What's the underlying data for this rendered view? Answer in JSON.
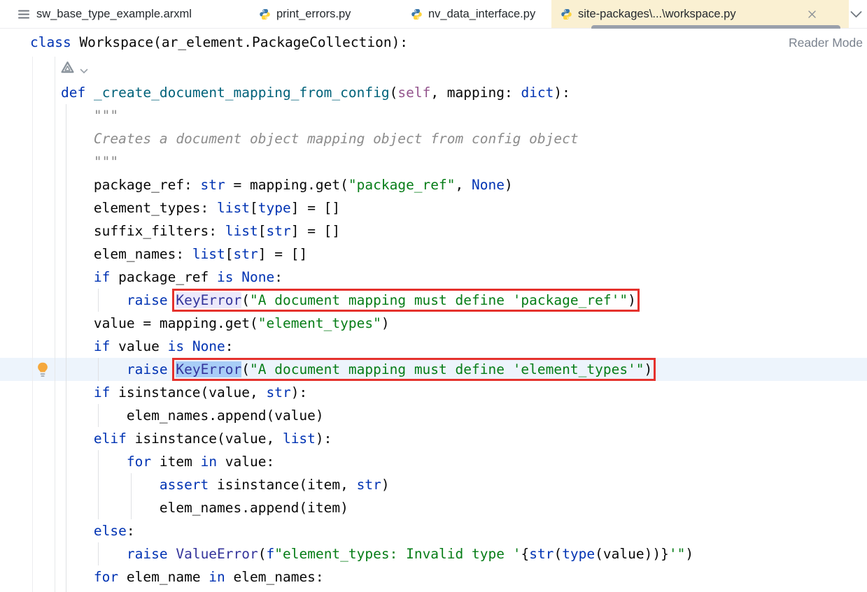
{
  "tabs": {
    "items": [
      {
        "label": "sw_base_type_example.arxml",
        "icon": "arxml-file-icon",
        "active": false,
        "closable": false
      },
      {
        "label": "print_errors.py",
        "icon": "python-icon",
        "active": false,
        "closable": false
      },
      {
        "label": "nv_data_interface.py",
        "icon": "python-icon",
        "active": false,
        "closable": false
      },
      {
        "label": "site-packages\\...\\workspace.py",
        "icon": "python-icon",
        "active": true,
        "closable": true,
        "close_icon": "close-icon"
      }
    ],
    "overflow_icon": "chevron-down-icon",
    "active_tab_bg": "#FAF0D2"
  },
  "header": {
    "signature_segments": [
      {
        "t": "class",
        "s": "kw"
      },
      {
        "t": " Workspace(ar_element.PackageCollection):",
        "s": "pl"
      }
    ],
    "reader_mode_label": "Reader Mode"
  },
  "colors": {
    "keyword": "#0033B3",
    "function_decl": "#00627A",
    "self_param": "#94558D",
    "string": "#067D17",
    "exception_ref": "#34349B",
    "docstring": "#8C8C8C",
    "annotation_box_red": "#E5322D",
    "identifier_highlight": "#ECE9FB",
    "selection_highlight": "#A8CDF7",
    "current_line": "#EDF4FC"
  },
  "editor": {
    "gutter_icons": [
      {
        "name": "lightbulb-icon",
        "line_index": 13
      },
      {
        "name": "inlay-hint-icon",
        "line_index": 0
      },
      {
        "name": "inlay-chevron-down-icon",
        "line_index": 0
      }
    ],
    "lines": [
      {
        "type": "inlay"
      },
      {
        "seg": [
          {
            "t": "    ",
            "s": "pl"
          },
          {
            "t": "def",
            "s": "kw"
          },
          {
            "t": " ",
            "s": "pl"
          },
          {
            "t": "_create_document_mapping_from_config",
            "s": "fn"
          },
          {
            "t": "(",
            "s": "pl"
          },
          {
            "t": "self",
            "s": "self"
          },
          {
            "t": ", mapping: ",
            "s": "pl"
          },
          {
            "t": "dict",
            "s": "kw"
          },
          {
            "t": "):",
            "s": "pl"
          }
        ]
      },
      {
        "seg": [
          {
            "t": "        \"\"\"",
            "s": "doc"
          }
        ]
      },
      {
        "seg": [
          {
            "t": "        Creates a document object mapping object from config object",
            "s": "doc"
          }
        ]
      },
      {
        "seg": [
          {
            "t": "        \"\"\"",
            "s": "doc"
          }
        ]
      },
      {
        "seg": [
          {
            "t": "        package_ref: ",
            "s": "pl"
          },
          {
            "t": "str",
            "s": "kw"
          },
          {
            "t": " = mapping.get(",
            "s": "pl"
          },
          {
            "t": "\"package_ref\"",
            "s": "str"
          },
          {
            "t": ", ",
            "s": "pl"
          },
          {
            "t": "None",
            "s": "kw"
          },
          {
            "t": ")",
            "s": "pl"
          }
        ]
      },
      {
        "seg": [
          {
            "t": "        element_types: ",
            "s": "pl"
          },
          {
            "t": "list",
            "s": "kw"
          },
          {
            "t": "[",
            "s": "pl"
          },
          {
            "t": "type",
            "s": "kw"
          },
          {
            "t": "] = []",
            "s": "pl"
          }
        ]
      },
      {
        "seg": [
          {
            "t": "        suffix_filters: ",
            "s": "pl"
          },
          {
            "t": "list",
            "s": "kw"
          },
          {
            "t": "[",
            "s": "pl"
          },
          {
            "t": "str",
            "s": "kw"
          },
          {
            "t": "] = []",
            "s": "pl"
          }
        ]
      },
      {
        "seg": [
          {
            "t": "        elem_names: ",
            "s": "pl"
          },
          {
            "t": "list",
            "s": "kw"
          },
          {
            "t": "[",
            "s": "pl"
          },
          {
            "t": "str",
            "s": "kw"
          },
          {
            "t": "] = []",
            "s": "pl"
          }
        ]
      },
      {
        "seg": [
          {
            "t": "        ",
            "s": "pl"
          },
          {
            "t": "if",
            "s": "kw"
          },
          {
            "t": " package_ref ",
            "s": "pl"
          },
          {
            "t": "is",
            "s": "kw"
          },
          {
            "t": " ",
            "s": "pl"
          },
          {
            "t": "None",
            "s": "kw"
          },
          {
            "t": ":",
            "s": "pl"
          }
        ]
      },
      {
        "seg": [
          {
            "t": "            ",
            "s": "pl"
          },
          {
            "t": "raise",
            "s": "kw"
          },
          {
            "t": " ",
            "s": "pl"
          },
          {
            "t": "KeyError",
            "s": "exc",
            "hl": "lav",
            "box": true
          },
          {
            "t": "(",
            "s": "pl",
            "box": true
          },
          {
            "t": "\"A document mapping must define 'package_ref'\"",
            "s": "str",
            "box": true
          },
          {
            "t": ")",
            "s": "pl",
            "box": true
          }
        ]
      },
      {
        "seg": [
          {
            "t": "        value = mapping.get(",
            "s": "pl"
          },
          {
            "t": "\"element_types\"",
            "s": "str"
          },
          {
            "t": ")",
            "s": "pl"
          }
        ]
      },
      {
        "seg": [
          {
            "t": "        ",
            "s": "pl"
          },
          {
            "t": "if",
            "s": "kw"
          },
          {
            "t": " value ",
            "s": "pl"
          },
          {
            "t": "is",
            "s": "kw"
          },
          {
            "t": " ",
            "s": "pl"
          },
          {
            "t": "None",
            "s": "kw"
          },
          {
            "t": ":",
            "s": "pl"
          }
        ]
      },
      {
        "current": true,
        "seg": [
          {
            "t": "            ",
            "s": "pl"
          },
          {
            "t": "raise",
            "s": "kw"
          },
          {
            "t": " ",
            "s": "pl"
          },
          {
            "t": "KeyError",
            "s": "exc",
            "hl": "sel",
            "box": true
          },
          {
            "t": "(",
            "s": "pl",
            "box": true
          },
          {
            "t": "\"A document mapping must define 'element_types'\"",
            "s": "str",
            "box": true
          },
          {
            "t": ")",
            "s": "pl",
            "box": true
          }
        ]
      },
      {
        "seg": [
          {
            "t": "        ",
            "s": "pl"
          },
          {
            "t": "if",
            "s": "kw"
          },
          {
            "t": " isinstance(value, ",
            "s": "pl"
          },
          {
            "t": "str",
            "s": "kw"
          },
          {
            "t": "):",
            "s": "pl"
          }
        ]
      },
      {
        "seg": [
          {
            "t": "            elem_names.append(value)",
            "s": "pl"
          }
        ]
      },
      {
        "seg": [
          {
            "t": "        ",
            "s": "pl"
          },
          {
            "t": "elif",
            "s": "kw"
          },
          {
            "t": " isinstance(value, ",
            "s": "pl"
          },
          {
            "t": "list",
            "s": "kw"
          },
          {
            "t": "):",
            "s": "pl"
          }
        ]
      },
      {
        "seg": [
          {
            "t": "            ",
            "s": "pl"
          },
          {
            "t": "for",
            "s": "kw"
          },
          {
            "t": " item ",
            "s": "pl"
          },
          {
            "t": "in",
            "s": "kw"
          },
          {
            "t": " value:",
            "s": "pl"
          }
        ]
      },
      {
        "seg": [
          {
            "t": "                ",
            "s": "pl"
          },
          {
            "t": "assert",
            "s": "kw"
          },
          {
            "t": " isinstance(item, ",
            "s": "pl"
          },
          {
            "t": "str",
            "s": "kw"
          },
          {
            "t": ")",
            "s": "pl"
          }
        ]
      },
      {
        "seg": [
          {
            "t": "                elem_names.append(item)",
            "s": "pl"
          }
        ]
      },
      {
        "seg": [
          {
            "t": "        ",
            "s": "pl"
          },
          {
            "t": "else",
            "s": "kw"
          },
          {
            "t": ":",
            "s": "pl"
          }
        ]
      },
      {
        "seg": [
          {
            "t": "            ",
            "s": "pl"
          },
          {
            "t": "raise",
            "s": "kw"
          },
          {
            "t": " ",
            "s": "pl"
          },
          {
            "t": "ValueError",
            "s": "exc"
          },
          {
            "t": "(",
            "s": "pl"
          },
          {
            "t": "f",
            "s": "kw"
          },
          {
            "t": "\"element_types: Invalid type '",
            "s": "str"
          },
          {
            "t": "{",
            "s": "pl"
          },
          {
            "t": "str",
            "s": "kw"
          },
          {
            "t": "(",
            "s": "pl"
          },
          {
            "t": "type",
            "s": "kw"
          },
          {
            "t": "(value))}",
            "s": "pl"
          },
          {
            "t": "'\"",
            "s": "str"
          },
          {
            "t": ")",
            "s": "pl"
          }
        ]
      },
      {
        "seg": [
          {
            "t": "        ",
            "s": "pl"
          },
          {
            "t": "for",
            "s": "kw"
          },
          {
            "t": " elem_name ",
            "s": "pl"
          },
          {
            "t": "in",
            "s": "kw"
          },
          {
            "t": " elem_names:",
            "s": "pl"
          }
        ]
      }
    ]
  }
}
